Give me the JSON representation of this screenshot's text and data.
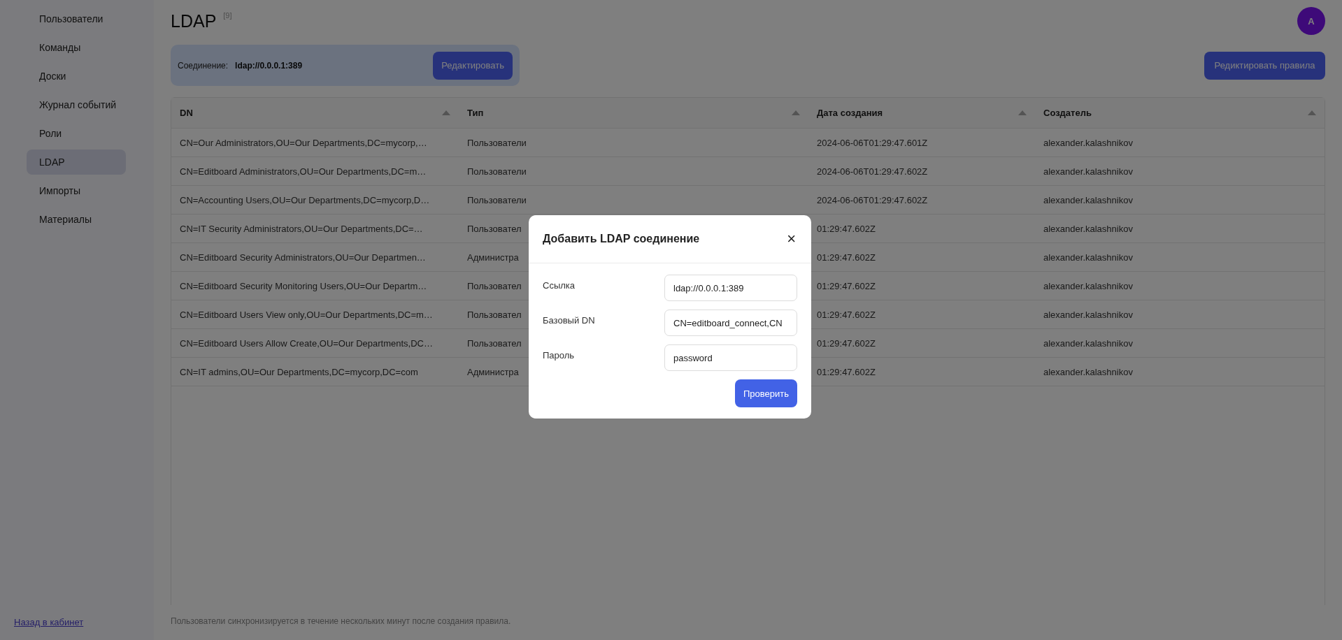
{
  "sidebar": {
    "items": [
      {
        "label": "Пользователи",
        "selected": false
      },
      {
        "label": "Команды",
        "selected": false
      },
      {
        "label": "Доски",
        "selected": false
      },
      {
        "label": "Журнал событий",
        "selected": false
      },
      {
        "label": "Роли",
        "selected": false
      },
      {
        "label": "LDAP",
        "selected": true
      },
      {
        "label": "Импорты",
        "selected": false
      },
      {
        "label": "Материалы",
        "selected": false
      }
    ],
    "back_link": "Назад в кабинет"
  },
  "header": {
    "title": "LDAP",
    "count": "[9]",
    "avatar": "A"
  },
  "connection": {
    "label": "Соединение:",
    "value": "ldap://0.0.0.1:389",
    "edit_button": "Редактировать"
  },
  "rules_button": "Редиктировать правила",
  "table": {
    "columns": [
      "DN",
      "Тип",
      "Дата создания",
      "Создатель"
    ],
    "rows": [
      [
        "CN=Our Administrators,OU=Our Departments,DC=mycorp,…",
        "Пользователи",
        "2024-06-06T01:29:47.601Z",
        "alexander.kalashnikov"
      ],
      [
        "CN=Editboard Administrators,OU=Our Departments,DC=m…",
        "Пользователи",
        "2024-06-06T01:29:47.602Z",
        "alexander.kalashnikov"
      ],
      [
        "CN=Accounting Users,OU=Our Departments,DC=mycorp,D…",
        "Пользователи",
        "2024-06-06T01:29:47.602Z",
        "alexander.kalashnikov"
      ],
      [
        "CN=IT Security Administrators,OU=Our Departments,DC=…",
        "Пользовател",
        "01:29:47.602Z",
        "alexander.kalashnikov"
      ],
      [
        "CN=Editboard Security Administrators,OU=Our Departmen…",
        "Администра",
        "01:29:47.602Z",
        "alexander.kalashnikov"
      ],
      [
        "CN=Editboard Security Monitoring Users,OU=Our Departm…",
        "Пользовател",
        "01:29:47.602Z",
        "alexander.kalashnikov"
      ],
      [
        "CN=Editboard Users View only,OU=Our Departments,DC=m…",
        "Пользовател",
        "01:29:47.602Z",
        "alexander.kalashnikov"
      ],
      [
        "CN=Editboard Users Allow Create,OU=Our Departments,DC…",
        "Пользовател",
        "01:29:47.602Z",
        "alexander.kalashnikov"
      ],
      [
        "CN=IT admins,OU=Our Departments,DC=mycorp,DC=com",
        "Администра",
        "01:29:47.602Z",
        "alexander.kalashnikov"
      ]
    ]
  },
  "footer_note": "Пользователи синхронизируется в течение нескольких минут после создания правила.",
  "modal": {
    "title": "Добавить LDAP соединение",
    "close": "×",
    "fields": [
      {
        "label": "Ссылка",
        "value": "ldap://0.0.0.1:389"
      },
      {
        "label": "Базовый DN",
        "value": "CN=editboard_connect,CN"
      },
      {
        "label": "Пароль",
        "value": "password"
      }
    ],
    "submit": "Проверить"
  }
}
